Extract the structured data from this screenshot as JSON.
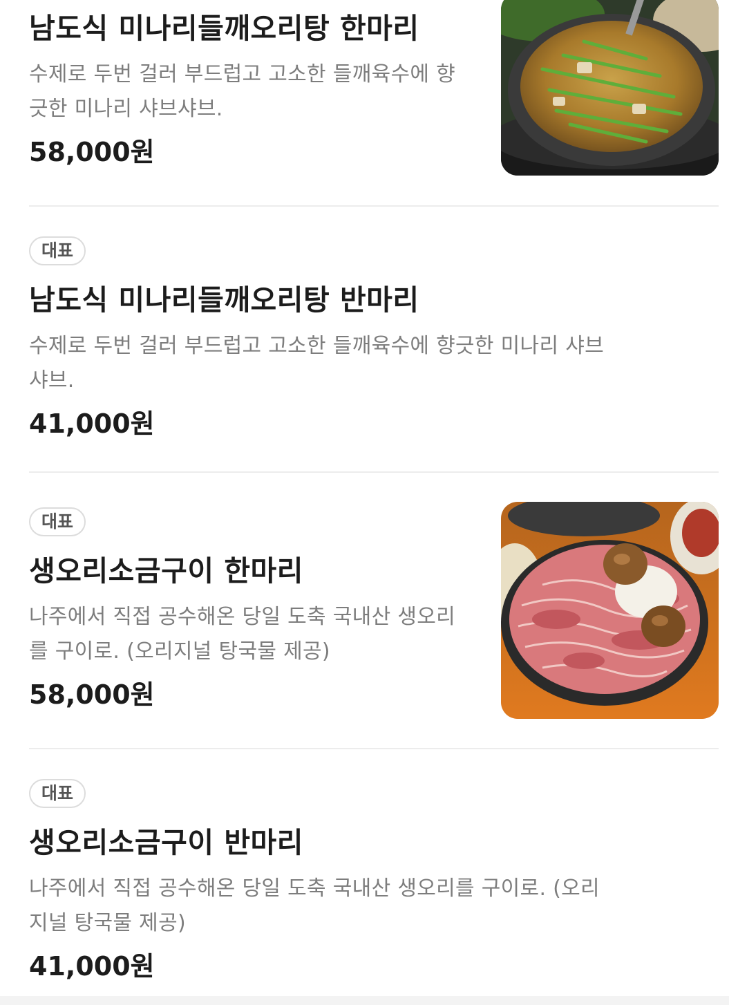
{
  "menu": {
    "items": [
      {
        "badge": "",
        "name": "남도식 미나리들깨오리탕 한마리",
        "description": "수제로 두번 걸러 부드럽고 고소한 들깨육수에 향긋한 미나리 샤브샤브.",
        "price": "58,000원",
        "image": "perilla-duck-soup-photo"
      },
      {
        "badge": "대표",
        "name": "남도식 미나리들깨오리탕 반마리",
        "description": "수제로 두번 걸러 부드럽고 고소한 들깨육수에 향긋한 미나리 샤브샤브.",
        "price": "41,000원"
      },
      {
        "badge": "대표",
        "name": "생오리소금구이 한마리",
        "description": "나주에서 직접 공수해온 당일 도축 국내산 생오리를 구이로. (오리지널 탕국물 제공)",
        "price": "58,000원",
        "image": "grilled-duck-photo"
      },
      {
        "badge": "대표",
        "name": "생오리소금구이 반마리",
        "description": "나주에서 직접 공수해온 당일 도축 국내산 생오리를 구이로. (오리지널 탕국물 제공)",
        "price": "41,000원"
      }
    ]
  }
}
